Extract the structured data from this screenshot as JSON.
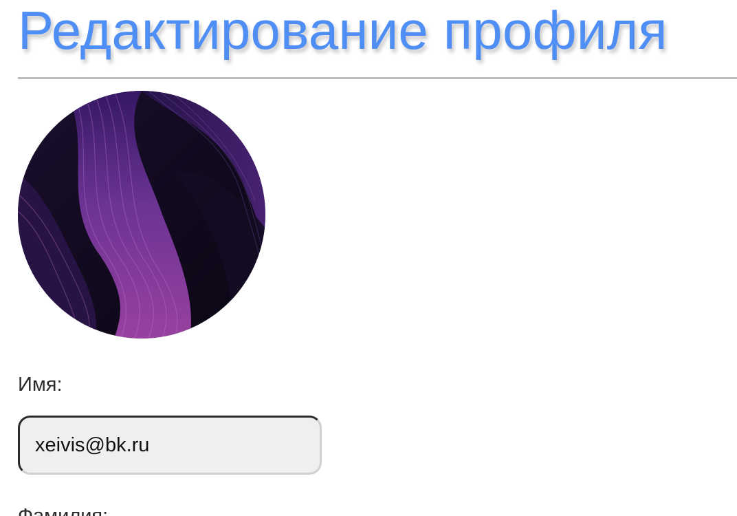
{
  "header": {
    "title": "Редактирование профиля",
    "title_color": "#4f8ef5"
  },
  "profile": {
    "avatar_icon": "abstract-purple-swirl-avatar"
  },
  "form": {
    "name_label": "Имя:",
    "name_value": "xeivis@bk.ru",
    "surname_label": "Фамилия:"
  }
}
